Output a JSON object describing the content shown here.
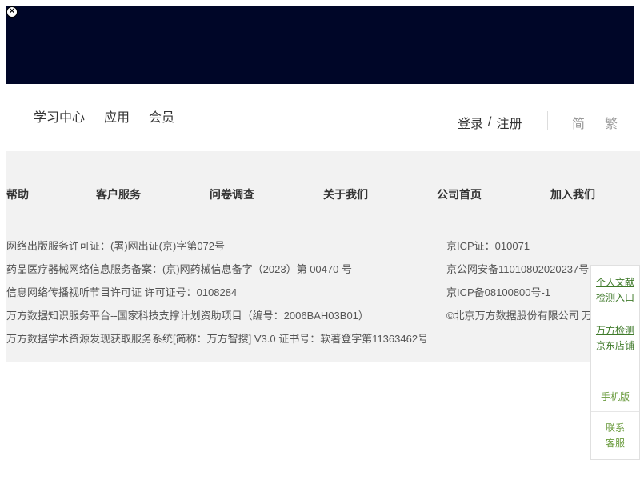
{
  "close": {
    "glyph": "×"
  },
  "topnav": [
    "学习中心",
    "应用",
    "会员"
  ],
  "auth": {
    "login": "登录",
    "sep": "/",
    "register": "注册"
  },
  "lang": {
    "simplified": "简",
    "traditional": "繁"
  },
  "footer": {
    "links": [
      "帮助",
      "客户服务",
      "问卷调查",
      "关于我们",
      "公司首页",
      "加入我们"
    ],
    "left": [
      "网络出版服务许可证：(署)网出证(京)字第072号",
      "药品医疗器械网络信息服务备案：(京)网药械信息备字（2023）第 00470 号",
      "信息网络传播视听节目许可证 许可证号：0108284",
      "万方数据知识服务平台--国家科技支撑计划资助项目（编号：2006BAH03B01）",
      "万方数据学术资源发现获取服务系统[简称：万方智搜] V3.0 证书号：软著登字第11363462号"
    ],
    "right": [
      "京ICP证：010071",
      "京公网安备11010802020237号",
      "京ICP备08100800号-1",
      "©北京万方数据股份有限公司 万"
    ]
  },
  "side": {
    "entry_line1": "个人文献",
    "entry_line2": "检测入口",
    "jd_line1": "万方检测",
    "jd_line2": "京东店铺",
    "mobile": "手机版",
    "contact_line1": "联系",
    "contact_line2": "客服"
  }
}
